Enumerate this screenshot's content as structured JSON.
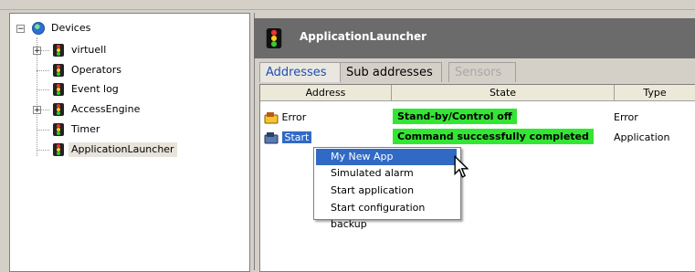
{
  "tree": {
    "root": {
      "label": "Devices",
      "expanded": true
    },
    "items": [
      {
        "label": "virtuell",
        "expandable": true
      },
      {
        "label": "Operators",
        "expandable": false
      },
      {
        "label": "Event log",
        "expandable": false
      },
      {
        "label": "AccessEngine",
        "expandable": true
      },
      {
        "label": "Timer",
        "expandable": false
      },
      {
        "label": "ApplicationLauncher",
        "expandable": false,
        "selected": true
      }
    ]
  },
  "panel": {
    "title": "ApplicationLauncher",
    "tabs": [
      {
        "label": "Addresses",
        "state": "active"
      },
      {
        "label": "Sub addresses",
        "state": "normal"
      },
      {
        "label": "Sensors",
        "state": "disabled"
      }
    ],
    "columns": [
      "Address",
      "State",
      "Type"
    ],
    "rows": [
      {
        "address": "Error",
        "state": "Stand-by/Control off",
        "type": "Error",
        "state_color": "#33e633"
      },
      {
        "address": "Start",
        "state": "Command successfully completed",
        "type": "Application",
        "state_color": "#33e633",
        "selected": true
      }
    ]
  },
  "context_menu": {
    "items": [
      {
        "label": "My New App",
        "highlighted": true
      },
      {
        "label": "Simulated alarm"
      },
      {
        "label": "Start application"
      },
      {
        "label": "Start configuration backup"
      }
    ]
  }
}
